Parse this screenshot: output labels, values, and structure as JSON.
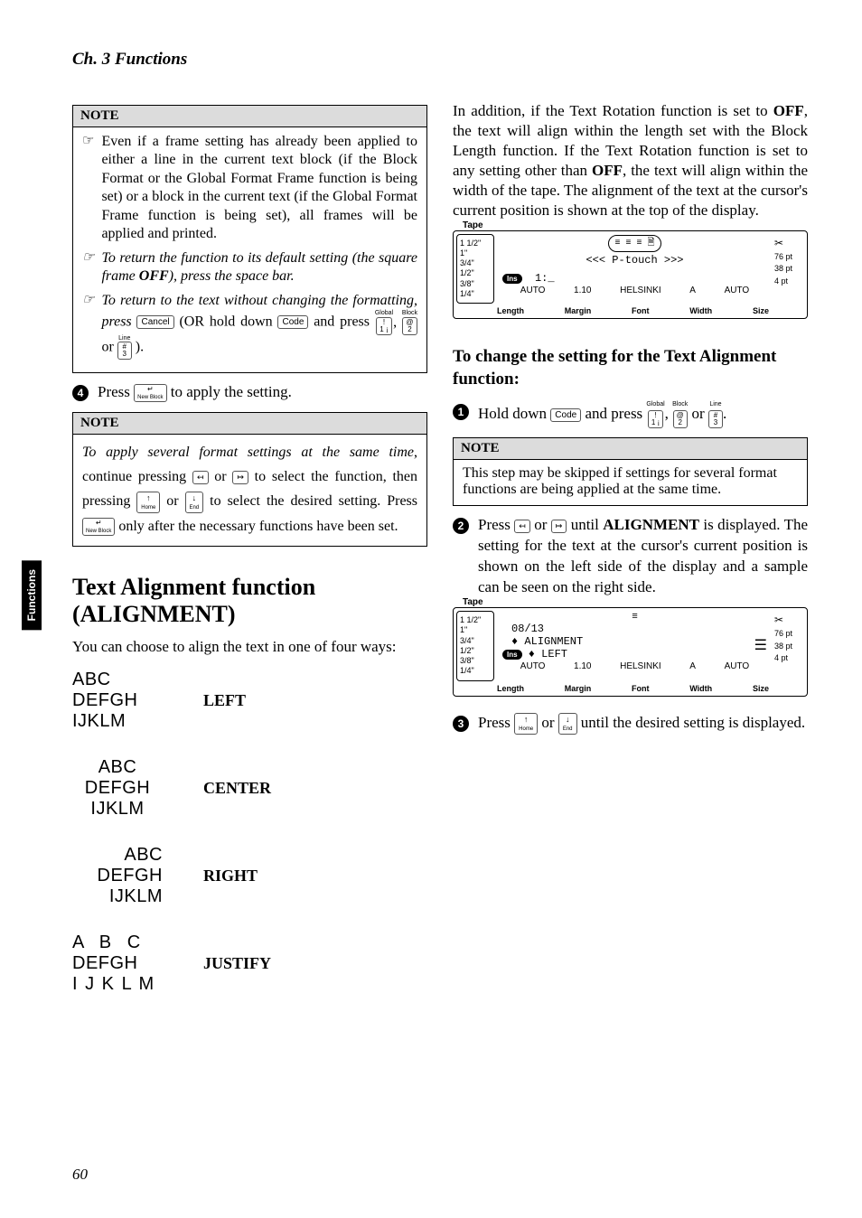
{
  "header": {
    "chapter": "Ch. 3 Functions"
  },
  "sideTab": "Functions",
  "pageNumber": "60",
  "left": {
    "note1": {
      "title": "NOTE",
      "items": [
        {
          "style": "plain",
          "text": "Even if a frame setting has already been applied to either a line in the current text block (if the Block Format or the Global Format Frame function is being set) or a block in the current text (if the Global Format Frame function is being set), all frames will be applied and printed."
        },
        {
          "style": "italic",
          "prefix": "To return the function to its default setting (the square frame ",
          "boldItalic": "OFF",
          "suffix": "), press the space bar."
        }
      ],
      "thirdPrefix": "To return to the text without changing the formatting, press ",
      "thirdMid1": " (OR hold down ",
      "thirdMid2": " and press ",
      "thirdOr": " or ",
      "thirdEnd": ")."
    },
    "keys": {
      "cancel": "Cancel",
      "code": "Code",
      "global": "Global",
      "block": "Block",
      "line": "Line",
      "k1top": "!",
      "k1bot": "1 ¡",
      "k2top": "@",
      "k2bot": "2",
      "k3top": "#",
      "k3bot": "3",
      "enterTop": "↵",
      "enterBot": "New\nBlock",
      "home": "Home",
      "end": "End",
      "left": "←",
      "right": "→",
      "up": "↑",
      "down": "↓"
    },
    "step4Pre": "Press ",
    "step4Post": " to apply the setting.",
    "note2": {
      "title": "NOTE",
      "line1a": "To apply several format settings at the same time",
      "line1b": ", continue pressing ",
      "line1c": " or ",
      "line1d": " to select the function, then pressing ",
      "line1e": " or ",
      "line1f": " to select the desired setting. Press ",
      "line1g": " only after the necessary functions have been set."
    },
    "section": {
      "title1": "Text Alignment function",
      "title2": "(ALIGNMENT)",
      "intro": "You can choose to align the text in one of four ways:"
    },
    "alignments": [
      {
        "l1": "ABC",
        "l2": "DEFGH",
        "l3": "IJKLM",
        "label": "LEFT",
        "mode": "left"
      },
      {
        "l1": "ABC",
        "l2": "DEFGH",
        "l3": "IJKLM",
        "label": "CENTER",
        "mode": "center"
      },
      {
        "l1": "ABC",
        "l2": "DEFGH",
        "l3": "IJKLM",
        "label": "RIGHT",
        "mode": "right"
      },
      {
        "l1": "A B C",
        "l2": "DEFGH",
        "l3": "I J K L M",
        "label": "JUSTIFY",
        "mode": "just"
      }
    ]
  },
  "right": {
    "introPara": {
      "p1": "In addition, if the Text Rotation function is set to ",
      "b1": "OFF",
      "p2": ", the text will align within the length set with the Block Length function. If the Text Rotation function is set to any setting other than ",
      "b2": "OFF",
      "p3": ", the text will align within the width of the tape. The alignment of the text at the cursor's current position is shown at the top of the display."
    },
    "lcd1": {
      "tape": "Tape",
      "tapeSizes": [
        "1 1/2\"",
        "1\"",
        "3/4\"",
        "1/2\"",
        "3/8\"",
        "1/4\""
      ],
      "ins": "Ins",
      "mainL1": "<<< P-touch >>>",
      "mainL2": "1:_",
      "status": [
        "AUTO",
        "1.10",
        "HELSINKI",
        "A",
        "AUTO"
      ],
      "labels": [
        "Length",
        "Margin",
        "Font",
        "Width",
        "Size"
      ],
      "pts": [
        "76 pt",
        "38 pt",
        "4 pt"
      ]
    },
    "subheading": "To change the setting for the Text Alignment function:",
    "step1": {
      "pre": "Hold down ",
      "mid": " and press ",
      "or": " or ",
      "end": "."
    },
    "note3": {
      "title": "NOTE",
      "body": "This step may be skipped if settings for several format functions are being applied at the same time."
    },
    "step2": {
      "pre": "Press ",
      "or": " or ",
      "mid": " until ",
      "bold": "ALIGNMENT",
      "post": " is displayed. The setting for the text at the cursor's current position is shown on the left side of the display and a sample can be seen on the right side."
    },
    "lcd2": {
      "mainL1": "08/13",
      "mainL2a": "♦ ALIGNMENT",
      "mainL2b": "♦ LEFT",
      "status": [
        "AUTO",
        "1.10",
        "HELSINKI",
        "A",
        "AUTO"
      ],
      "labels": [
        "Length",
        "Margin",
        "Font",
        "Width",
        "Size"
      ]
    },
    "step3": {
      "pre": "Press ",
      "or": " or ",
      "post": " until the desired setting is displayed."
    }
  }
}
